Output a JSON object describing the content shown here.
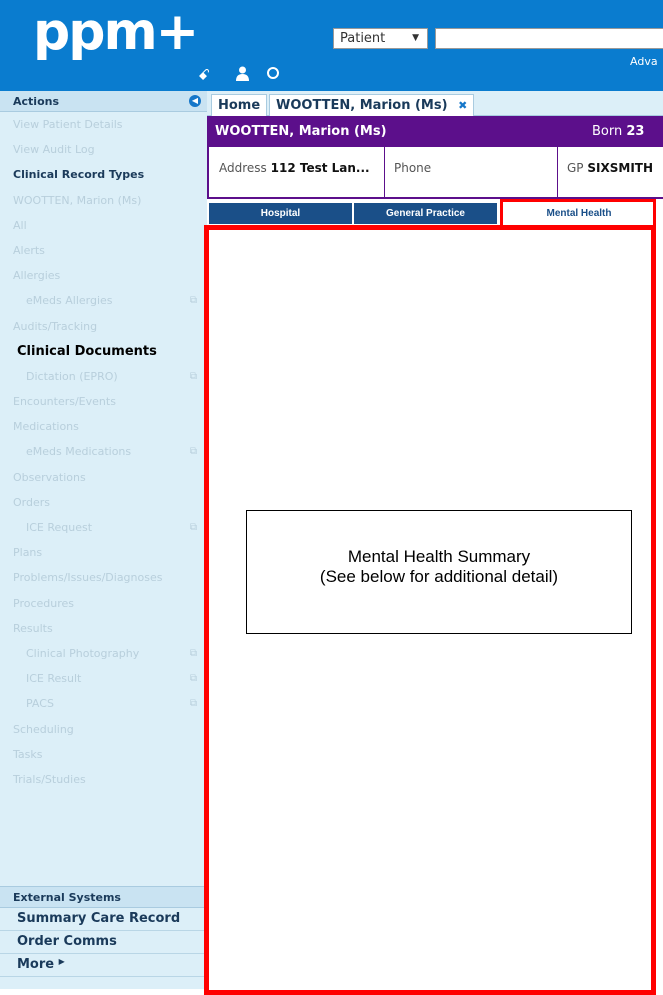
{
  "header": {
    "logo": "ppm+",
    "search_type": "Patient",
    "advanced_label": "Adva",
    "icons": [
      "sitemap-icon",
      "user-icon",
      "refresh-icon"
    ]
  },
  "sidebar": {
    "title": "Actions",
    "items": [
      {
        "label": "View Patient Details",
        "style": "muted"
      },
      {
        "label": "View Audit Log",
        "style": "muted"
      },
      {
        "label": "Clinical Record Types",
        "style": "bold"
      },
      {
        "label": "WOOTTEN, Marion (Ms)",
        "style": "muted"
      },
      {
        "label": "All",
        "style": "muted"
      },
      {
        "label": "Alerts",
        "style": "muted"
      },
      {
        "label": "Allergies",
        "style": "muted"
      },
      {
        "label": "eMeds Allergies",
        "style": "sub",
        "external": true
      },
      {
        "label": "Audits/Tracking",
        "style": "muted"
      },
      {
        "label": "Clinical Documents",
        "style": "emph"
      },
      {
        "label": "Dictation (EPRO)",
        "style": "sub",
        "external": true
      },
      {
        "label": "Encounters/Events",
        "style": "muted"
      },
      {
        "label": "Medications",
        "style": "muted"
      },
      {
        "label": "eMeds Medications",
        "style": "sub",
        "external": true
      },
      {
        "label": "Observations",
        "style": "muted"
      },
      {
        "label": "Orders",
        "style": "muted"
      },
      {
        "label": "ICE Request",
        "style": "sub",
        "external": true
      },
      {
        "label": "Plans",
        "style": "muted"
      },
      {
        "label": "Problems/Issues/Diagnoses",
        "style": "muted"
      },
      {
        "label": "Procedures",
        "style": "muted"
      },
      {
        "label": "Results",
        "style": "muted"
      },
      {
        "label": "Clinical Photography",
        "style": "sub",
        "external": true
      },
      {
        "label": "ICE Result",
        "style": "sub",
        "external": true
      },
      {
        "label": "PACS",
        "style": "sub",
        "external": true
      },
      {
        "label": "Scheduling",
        "style": "muted"
      },
      {
        "label": "Tasks",
        "style": "muted"
      },
      {
        "label": "Trials/Studies",
        "style": "muted"
      }
    ],
    "external_title": "External Systems",
    "external_items": [
      "Summary Care Record",
      "Order Comms",
      "More"
    ]
  },
  "tabs": [
    {
      "label": "Home"
    },
    {
      "label": "WOOTTEN, Marion (Ms)",
      "closable": true
    }
  ],
  "patient": {
    "name": "WOOTTEN, Marion (Ms)",
    "born_label": "Born",
    "born_value": "23",
    "address_label": "Address",
    "address_value": "112 Test Lan...",
    "phone_label": "Phone",
    "gp_label": "GP",
    "gp_value": "SIXSMITH"
  },
  "subtabs": [
    "Hospital",
    "General Practice",
    "Mental Health"
  ],
  "summary": {
    "line1": "Mental Health Summary",
    "line2": "(See below for additional detail)"
  },
  "colors": {
    "header_blue": "#0a7ccf",
    "banner_purple": "#5c0f8b",
    "annotation_red": "#ff0000",
    "sidebar_bg": "#dceff8"
  }
}
